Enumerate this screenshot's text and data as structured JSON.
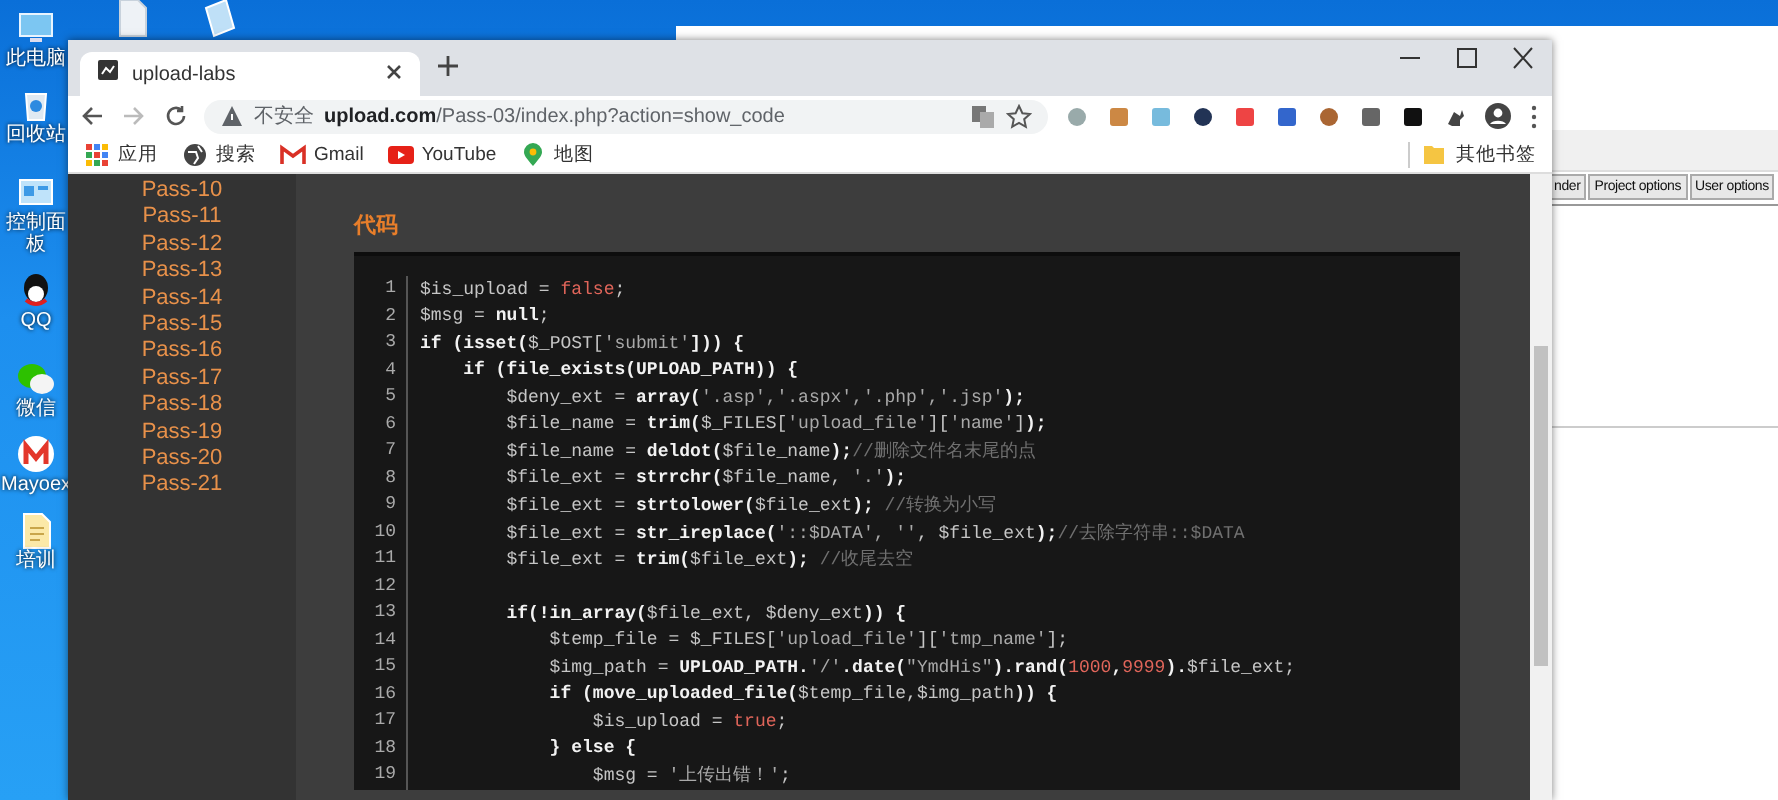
{
  "desktop": {
    "icons": [
      {
        "label": "此电脑",
        "kind": "pc"
      },
      {
        "label": "回收站",
        "kind": "bin"
      },
      {
        "label": "控制面板",
        "kind": "panel"
      },
      {
        "label": "QQ",
        "kind": "qq"
      },
      {
        "label": "微信",
        "kind": "chat"
      },
      {
        "label": "Mayoex",
        "kind": "m"
      },
      {
        "label": "培训",
        "kind": "doc"
      }
    ]
  },
  "background_window": {
    "tabs": [
      {
        "label": "nder",
        "selected": false
      },
      {
        "label": "Project options",
        "selected": false
      },
      {
        "label": "User options",
        "selected": false
      }
    ]
  },
  "browser": {
    "tab": {
      "title": "upload-labs"
    },
    "security": "不安全",
    "url_host": "upload.com",
    "url_path": "/Pass-03/index.php?action=show_code",
    "bookmarks": [
      {
        "label": "应用",
        "kind": "apps"
      },
      {
        "label": "搜索",
        "kind": "globe"
      },
      {
        "label": "Gmail",
        "kind": "gmail"
      },
      {
        "label": "YouTube",
        "kind": "youtube"
      },
      {
        "label": "地图",
        "kind": "maps"
      }
    ],
    "other_bookmarks": "其他书签"
  },
  "sidebar": {
    "items": [
      "Pass-10",
      "Pass-11",
      "Pass-12",
      "Pass-13",
      "Pass-14",
      "Pass-15",
      "Pass-16",
      "Pass-17",
      "Pass-18",
      "Pass-19",
      "Pass-20",
      "Pass-21"
    ]
  },
  "section_title": "代码",
  "code": {
    "lines": [
      {
        "number": "1",
        "segments": [
          {
            "kind": "v",
            "text": "$is_upload = "
          },
          {
            "kind": "l",
            "text": "false"
          },
          {
            "kind": "v",
            "text": ";"
          }
        ]
      },
      {
        "number": "2",
        "segments": [
          {
            "kind": "v",
            "text": "$msg = "
          },
          {
            "kind": "k",
            "text": "null"
          },
          {
            "kind": "v",
            "text": ";"
          }
        ]
      },
      {
        "number": "3",
        "segments": [
          {
            "kind": "k",
            "text": "if (isset("
          },
          {
            "kind": "v",
            "text": "$_POST["
          },
          {
            "kind": "s",
            "text": "'submit'"
          },
          {
            "kind": "k",
            "text": "])) {"
          }
        ]
      },
      {
        "number": "4",
        "segments": [
          {
            "kind": "k",
            "text": "    if (file_exists(UPLOAD_PATH)) {"
          }
        ]
      },
      {
        "number": "5",
        "segments": [
          {
            "kind": "v",
            "text": "        $deny_ext = "
          },
          {
            "kind": "k",
            "text": "array("
          },
          {
            "kind": "s",
            "text": "'.asp','.aspx','.php','.jsp'"
          },
          {
            "kind": "k",
            "text": ");"
          }
        ]
      },
      {
        "number": "6",
        "segments": [
          {
            "kind": "v",
            "text": "        $file_name = "
          },
          {
            "kind": "k",
            "text": "trim("
          },
          {
            "kind": "v",
            "text": "$_FILES["
          },
          {
            "kind": "s",
            "text": "'upload_file'"
          },
          {
            "kind": "v",
            "text": "]["
          },
          {
            "kind": "s",
            "text": "'name'"
          },
          {
            "kind": "v",
            "text": "]"
          },
          {
            "kind": "k",
            "text": ");"
          }
        ]
      },
      {
        "number": "7",
        "segments": [
          {
            "kind": "v",
            "text": "        $file_name = "
          },
          {
            "kind": "k",
            "text": "deldot("
          },
          {
            "kind": "v",
            "text": "$file_name"
          },
          {
            "kind": "k",
            "text": ");"
          },
          {
            "kind": "c",
            "text": "//删除文件名末尾的点"
          }
        ]
      },
      {
        "number": "8",
        "segments": [
          {
            "kind": "v",
            "text": "        $file_ext = "
          },
          {
            "kind": "k",
            "text": "strrchr("
          },
          {
            "kind": "v",
            "text": "$file_name, "
          },
          {
            "kind": "s",
            "text": "'.'"
          },
          {
            "kind": "k",
            "text": ");"
          }
        ]
      },
      {
        "number": "9",
        "segments": [
          {
            "kind": "v",
            "text": "        $file_ext = "
          },
          {
            "kind": "k",
            "text": "strtolower("
          },
          {
            "kind": "v",
            "text": "$file_ext"
          },
          {
            "kind": "k",
            "text": "); "
          },
          {
            "kind": "c",
            "text": "//转换为小写"
          }
        ]
      },
      {
        "number": "10",
        "segments": [
          {
            "kind": "v",
            "text": "        $file_ext = "
          },
          {
            "kind": "k",
            "text": "str_ireplace("
          },
          {
            "kind": "s",
            "text": "'::$DATA', ''"
          },
          {
            "kind": "v",
            "text": ", $file_ext"
          },
          {
            "kind": "k",
            "text": ");"
          },
          {
            "kind": "c",
            "text": "//去除字符串::$DATA"
          }
        ]
      },
      {
        "number": "11",
        "segments": [
          {
            "kind": "v",
            "text": "        $file_ext = "
          },
          {
            "kind": "k",
            "text": "trim("
          },
          {
            "kind": "v",
            "text": "$file_ext"
          },
          {
            "kind": "k",
            "text": "); "
          },
          {
            "kind": "c",
            "text": "//收尾去空"
          }
        ]
      },
      {
        "number": "12"
      },
      {
        "number": "13",
        "segments": [
          {
            "kind": "k",
            "text": "        if(!in_array("
          },
          {
            "kind": "v",
            "text": "$file_ext, $deny_ext"
          },
          {
            "kind": "k",
            "text": ")) {"
          }
        ]
      },
      {
        "number": "14",
        "segments": [
          {
            "kind": "v",
            "text": "            $temp_file = $_FILES["
          },
          {
            "kind": "s",
            "text": "'upload_file'"
          },
          {
            "kind": "v",
            "text": "]["
          },
          {
            "kind": "s",
            "text": "'tmp_name'"
          },
          {
            "kind": "v",
            "text": "];"
          }
        ]
      },
      {
        "number": "15",
        "segments": [
          {
            "kind": "v",
            "text": "            $img_path = "
          },
          {
            "kind": "k",
            "text": "UPLOAD_PATH."
          },
          {
            "kind": "s",
            "text": "'/'"
          },
          {
            "kind": "k",
            "text": ".date("
          },
          {
            "kind": "s",
            "text": "\"YmdHis\""
          },
          {
            "kind": "k",
            "text": ").rand("
          },
          {
            "kind": "l",
            "text": "1000"
          },
          {
            "kind": "k",
            "text": ","
          },
          {
            "kind": "l",
            "text": "9999"
          },
          {
            "kind": "k",
            "text": ")."
          },
          {
            "kind": "v",
            "text": "$file_ext;"
          }
        ]
      },
      {
        "number": "16",
        "segments": [
          {
            "kind": "k",
            "text": "            if (move_uploaded_file("
          },
          {
            "kind": "v",
            "text": "$temp_file,$img_path"
          },
          {
            "kind": "k",
            "text": ")) {"
          }
        ]
      },
      {
        "number": "17",
        "segments": [
          {
            "kind": "v",
            "text": "                $is_upload = "
          },
          {
            "kind": "l",
            "text": "true"
          },
          {
            "kind": "v",
            "text": ";"
          }
        ]
      },
      {
        "number": "18",
        "segments": [
          {
            "kind": "k",
            "text": "            } else {"
          }
        ]
      },
      {
        "number": "19",
        "segments": [
          {
            "kind": "v",
            "text": "                $msg = "
          },
          {
            "kind": "s",
            "text": "'上传出错！'"
          },
          {
            "kind": "v",
            "text": ";"
          }
        ]
      }
    ]
  }
}
